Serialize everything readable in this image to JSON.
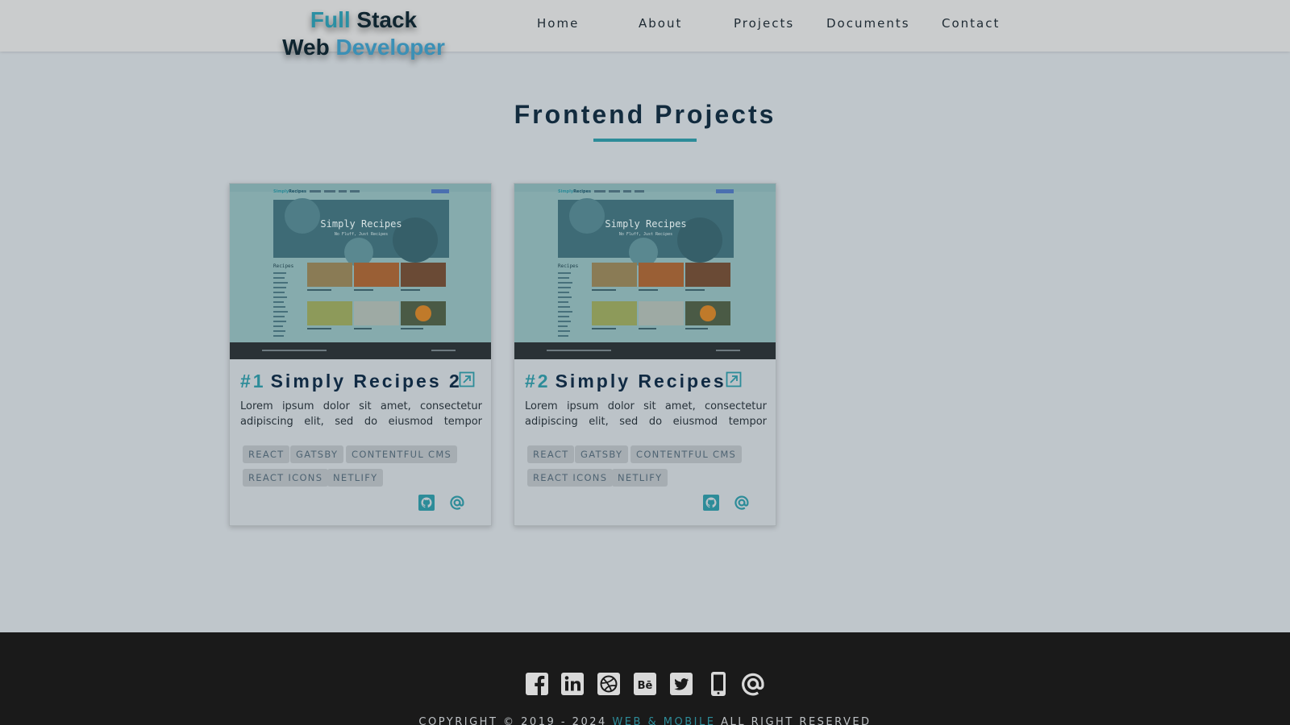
{
  "colors": {
    "accent": "#2d8c99",
    "page_bg": "#bfc6cb",
    "navbar_bg": "#cacccd",
    "footer_bg": "#1a1a1a",
    "heading": "#102a43"
  },
  "logo": {
    "line1_a": "Full",
    "line1_b": "Stack",
    "line2_a": "Web",
    "line2_b": "Developer"
  },
  "nav": {
    "items": [
      {
        "label": "Home"
      },
      {
        "label": "About"
      },
      {
        "label": "Projects"
      },
      {
        "label": "Documents"
      },
      {
        "label": "Contact"
      }
    ]
  },
  "section": {
    "title": "Frontend Projects"
  },
  "thumbnail": {
    "brand_a": "Simply",
    "brand_b": "Recipes",
    "hero_title": "Simply Recipes",
    "hero_subtitle": "No Fluff, Just Recipes",
    "sidebar_heading": "Recipes"
  },
  "projects": [
    {
      "number": "#1",
      "title": "Simply Recipes 2",
      "description": "Lorem ipsum dolor sit amet, consectetur adipiscing elit, sed do eiusmod tempor incididunt ut labore et dolore magna aliqua.",
      "tags": [
        "REACT",
        "GATSBY",
        "CONTENTFUL CMS",
        "REACT ICONS",
        "NETLIFY"
      ],
      "icons": [
        "external-link-icon",
        "github-icon",
        "at-sign-icon"
      ]
    },
    {
      "number": "#2",
      "title": "Simply Recipes",
      "description": "Lorem ipsum dolor sit amet, consectetur adipiscing elit, sed do eiusmod tempor incididunt ut labore et dolore magna aliqua.",
      "tags": [
        "REACT",
        "GATSBY",
        "CONTENTFUL CMS",
        "REACT ICONS",
        "NETLIFY"
      ],
      "icons": [
        "external-link-icon",
        "github-icon",
        "at-sign-icon"
      ]
    }
  ],
  "footer": {
    "social_icons": [
      "facebook-icon",
      "linkedin-icon",
      "dribbble-icon",
      "behance-icon",
      "twitter-icon",
      "phone-icon",
      "at-sign-icon"
    ],
    "copyright_prefix": "COPYRIGHT © 2019 - 2024",
    "copyright_brand": "WEB & MOBILE",
    "copyright_suffix": "ALL RIGHT RESERVED"
  }
}
